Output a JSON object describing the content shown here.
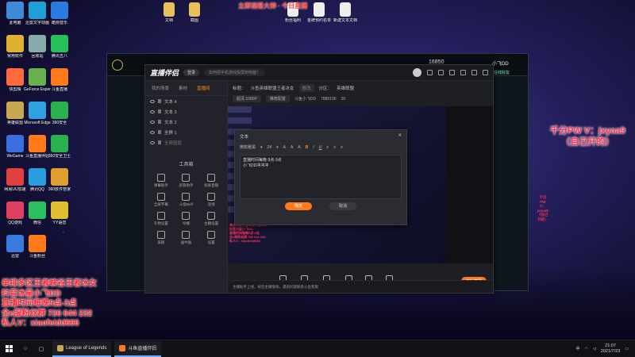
{
  "overlay": {
    "top_red": "立即观看大神 · 今日直播",
    "pw_lines": [
      "千分PW V：jxyaa9",
      "（自己开的）"
    ],
    "promo_lines": [
      "单排多区王者峡谷王者冰女",
      "抖音冰星小飞DD",
      "直播时间每晚9点-3点",
      "全e服粉丝群 726 644 232",
      "私人V：xiaofeidd666"
    ]
  },
  "desktop_icons": [
    {
      "label": "此电脑",
      "color": "#3d8bd8"
    },
    {
      "label": "迅雷文字动画",
      "color": "#1e9fd8"
    },
    {
      "label": "酷狗音乐",
      "color": "#2a7be0"
    },
    {
      "label": "常用软件",
      "color": "#e0b030"
    },
    {
      "label": "回收站",
      "color": "#8aa"
    },
    {
      "label": "腾讯五八",
      "color": "#25c05a"
    },
    {
      "label": "快剪辑",
      "color": "#ff6a3c"
    },
    {
      "label": "GeForce Experience",
      "color": "#6ab04c"
    },
    {
      "label": "斗鱼直播",
      "color": "#ff7a1a"
    },
    {
      "label": "英雄联盟",
      "color": "#c8a752"
    },
    {
      "label": "Microsoft Edge",
      "color": "#2fa0e0"
    },
    {
      "label": "360安全",
      "color": "#2ab04c"
    },
    {
      "label": "WeGame",
      "color": "#3a6fe0"
    },
    {
      "label": "斗鱼直播伴侣",
      "color": "#ff7a1a"
    },
    {
      "label": "360安全卫士",
      "color": "#2ab04c"
    },
    {
      "label": "网易UU加速",
      "color": "#e04040"
    },
    {
      "label": "腾讯QQ",
      "color": "#2a9de0"
    },
    {
      "label": "360软件管家",
      "color": "#e0a030"
    },
    {
      "label": "QQ游戏",
      "color": "#e04060"
    },
    {
      "label": "微信",
      "color": "#2ac060"
    },
    {
      "label": "YY语音",
      "color": "#e0c030"
    },
    {
      "label": "迅雷",
      "color": "#3a7ae0"
    },
    {
      "label": "斗鱼粉丝",
      "color": "#ff7a1a"
    }
  ],
  "top_files": [
    {
      "label": "文档"
    },
    {
      "label": "截图"
    },
    {
      "label": "粉丝福利"
    },
    {
      "label": "金牌预约名单"
    },
    {
      "label": "新建文本文档"
    }
  ],
  "lol": {
    "money": "16850",
    "user": "小飞DD",
    "friends": "在线好友"
  },
  "helper": {
    "logo": "直播伴侣",
    "version_btn": "登录",
    "ticker": "如何把手机游戏投屏到电脑？",
    "title_label": "标题：",
    "title_value": "斗鱼英雄联盟王者冰女",
    "edit_pill": "修改",
    "category_label": "分区：",
    "category_value": "英雄联盟",
    "fans_label": "斗鱼小飞DD",
    "room_id": "7885190",
    "viewers": "20",
    "resolution_pill": "超清 1080P",
    "bitrate_pill": "推荐配置",
    "left_tabs": [
      "我的场景",
      "素材",
      "直播间"
    ],
    "sources": [
      "文本 4",
      "文本 3",
      "文本 2",
      "全屏 1",
      "全屏图层"
    ],
    "tools_title": "工具箱",
    "tools": [
      "弹幕助手",
      "房管助手",
      "投屏直播",
      "全屏字幕",
      "斗鱼Buff",
      "连线",
      "礼物设置",
      "导播",
      "主播设置",
      "美颜",
      "画中画",
      "设置"
    ],
    "bottom_tools": [
      "直播屏幕",
      "摄像头",
      "手机投屏",
      "多媒体",
      "麦克风",
      "扬声器"
    ],
    "go_live": "开始直播",
    "status": "主播助手上线，祝您主播愉快，遇到问题联系斗鱼客服"
  },
  "dialog": {
    "title": "文本",
    "font": "微软雅黑",
    "size": "24",
    "text_lines": [
      "直播时间每晚 9点-3点",
      "小飞DD冲冲冲"
    ],
    "ok": "确定",
    "cancel": "取消"
  },
  "taskbar": {
    "apps": [
      {
        "label": "League of Legends",
        "color": "#c8a752"
      },
      {
        "label": "斗鱼直播伴侣",
        "color": "#ff7a1a"
      }
    ],
    "ime": "中",
    "time": "21:07",
    "date": "2021/7/23"
  }
}
